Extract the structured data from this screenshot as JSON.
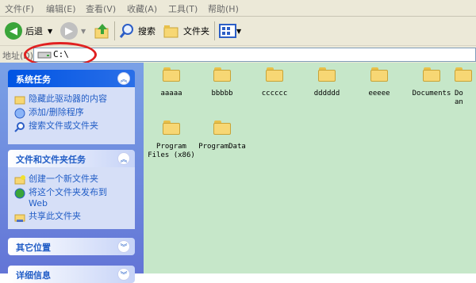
{
  "menu": {
    "items": [
      "文件(F)",
      "编辑(E)",
      "查看(V)",
      "收藏(A)",
      "工具(T)",
      "帮助(H)"
    ]
  },
  "toolbar": {
    "back_label": "后退",
    "search_label": "搜索",
    "folders_label": "文件夹"
  },
  "address": {
    "label": "地址(D)",
    "value": "C:\\"
  },
  "sidebar": {
    "system_tasks": {
      "title": "系统任务",
      "items": [
        "隐藏此驱动器的内容",
        "添加/删除程序",
        "搜索文件或文件夹"
      ]
    },
    "file_tasks": {
      "title": "文件和文件夹任务",
      "items": [
        "创建一个新文件夹",
        "将这个文件夹发布到Web",
        "共享此文件夹"
      ]
    },
    "other_places": {
      "title": "其它位置"
    },
    "details": {
      "title": "详细信息"
    }
  },
  "folders": [
    "aaaaa",
    "bbbbb",
    "cccccc",
    "dddddd",
    "eeeee",
    "Documents",
    "Do\nan",
    "Program\nFiles (x86)",
    "ProgramData"
  ],
  "colors": {
    "content_bg": "#c6e7c9",
    "sidebar_bg": "#6f8ddf",
    "highlight_circle": "#e02020"
  }
}
